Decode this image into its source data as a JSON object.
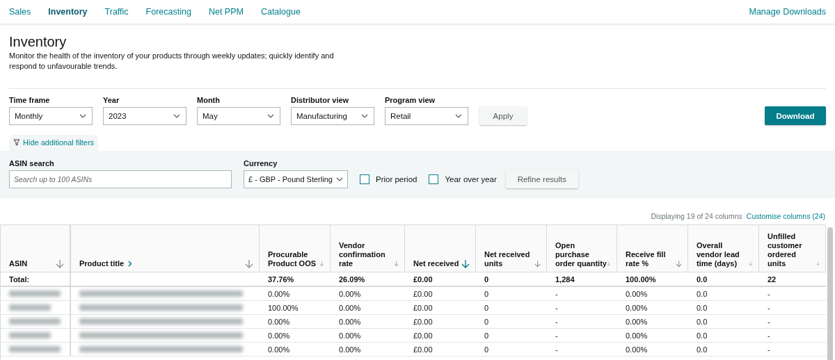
{
  "nav": {
    "tabs": [
      {
        "label": "Sales",
        "selected": false
      },
      {
        "label": "Inventory",
        "selected": true
      },
      {
        "label": "Traffic",
        "selected": false
      },
      {
        "label": "Forecasting",
        "selected": false
      },
      {
        "label": "Net PPM",
        "selected": false
      },
      {
        "label": "Catalogue",
        "selected": false
      }
    ],
    "link": "Manage Downloads"
  },
  "page": {
    "title": "Inventory",
    "description": "Monitor the health of the inventory of your products through weekly updates; quickly identify and respond to unfavourable trends."
  },
  "filters": [
    {
      "label": "Time frame",
      "value": "Monthly"
    },
    {
      "label": "Year",
      "value": "2023"
    },
    {
      "label": "Month",
      "value": "May"
    },
    {
      "label": "Distributor view",
      "value": "Manufacturing"
    },
    {
      "label": "Program view",
      "value": "Retail"
    }
  ],
  "apply": "Apply",
  "download": "Download",
  "toggle": "Hide additional filters",
  "additional": {
    "asin_search": {
      "label": "ASIN search",
      "placeholder": "Search up to 100 ASINs"
    },
    "currency": {
      "label": "Currency",
      "value": "£ - GBP - Pound Sterling"
    },
    "checkboxes": [
      {
        "label": "Prior period",
        "checked": false
      },
      {
        "label": "Year over year",
        "checked": false
      }
    ],
    "refine": "Refine results"
  },
  "table": {
    "summary": "Displaying 19 of 24 columns",
    "customise": "Customise columns (24)",
    "columns": [
      {
        "label": "ASIN",
        "sorted": false,
        "expandable": false
      },
      {
        "label": "Product title",
        "sorted": false,
        "expandable": true
      },
      {
        "label": "Procurable Product OOS",
        "sorted": false,
        "expandable": false
      },
      {
        "label": "Vendor confirmation rate",
        "sorted": false,
        "expandable": false
      },
      {
        "label": "Net received",
        "sorted": true,
        "expandable": false
      },
      {
        "label": "Net received units",
        "sorted": false,
        "expandable": false
      },
      {
        "label": "Open purchase order quantity",
        "sorted": false,
        "expandable": false
      },
      {
        "label": "Receive fill rate %",
        "sorted": false,
        "expandable": false
      },
      {
        "label": "Overall vendor lead time (days)",
        "sorted": false,
        "expandable": false
      },
      {
        "label": "Unfilled customer ordered units",
        "sorted": false,
        "expandable": false
      }
    ],
    "rows": [
      [
        "Total:",
        "",
        "37.76%",
        "26.09%",
        "£0.00",
        "0",
        "1,284",
        "100.00%",
        "0.0",
        "22"
      ],
      [
        "",
        "",
        "0.00%",
        "0.00%",
        "£0.00",
        "0",
        "-",
        "0.00%",
        "0.0",
        "-"
      ],
      [
        "",
        "",
        "100.00%",
        "0.00%",
        "£0.00",
        "0",
        "-",
        "0.00%",
        "0.0",
        "-"
      ],
      [
        "",
        "",
        "0.00%",
        "0.00%",
        "£0.00",
        "0",
        "-",
        "0.00%",
        "0.0",
        "-"
      ],
      [
        "",
        "",
        "0.00%",
        "0.00%",
        "£0.00",
        "0",
        "-",
        "0.00%",
        "0.0",
        "-"
      ],
      [
        "",
        "",
        "0.00%",
        "0.00%",
        "£0.00",
        "0",
        "-",
        "0.00%",
        "0.0",
        "-"
      ]
    ]
  }
}
